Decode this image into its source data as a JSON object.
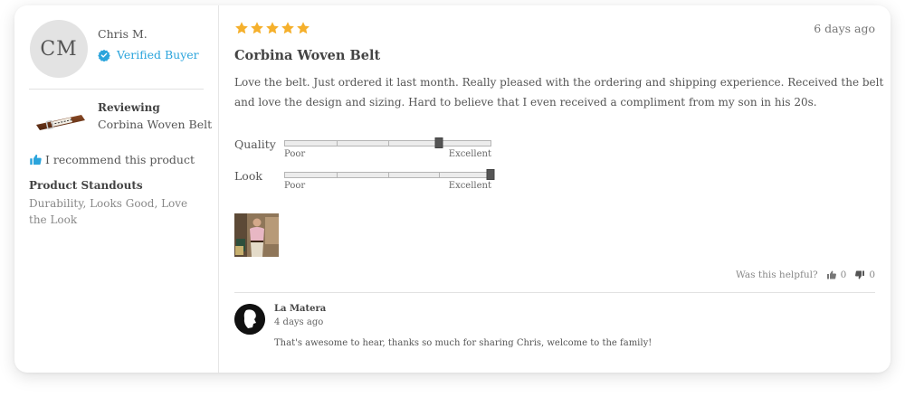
{
  "reviewer": {
    "initials": "CM",
    "name": "Chris M.",
    "badge": "Verified Buyer",
    "badge_icon": "verified-check-icon"
  },
  "reviewing": {
    "label": "Reviewing",
    "product_name": "Corbina Woven Belt"
  },
  "recommend": {
    "text": "I recommend this product",
    "icon": "thumbs-up-icon"
  },
  "standouts": {
    "title": "Product Standouts",
    "text": "Durability, Looks Good, Love the Look"
  },
  "review": {
    "rating": 5,
    "rating_max": 5,
    "date": "6 days ago",
    "title": "Corbina Woven Belt",
    "body": "Love the belt. Just ordered it last month. Really pleased with the ordering and shipping experience. Received the belt and love the design and sizing. Hard to believe that I even received a compliment from my son in his 20s."
  },
  "ratings": [
    {
      "label": "Quality",
      "min_label": "Poor",
      "max_label": "Excellent",
      "value": 0.75
    },
    {
      "label": "Look",
      "min_label": "Poor",
      "max_label": "Excellent",
      "value": 1.0
    }
  ],
  "helpful": {
    "label": "Was this helpful?",
    "up_count": "0",
    "down_count": "0"
  },
  "reply": {
    "author": "La Matera",
    "date": "4 days ago",
    "text": "That's awesome to hear, thanks so much for sharing Chris, welcome to the family!"
  },
  "colors": {
    "star": "#f5b02c",
    "accent": "#2aa4dc",
    "thumb": "#555555"
  }
}
